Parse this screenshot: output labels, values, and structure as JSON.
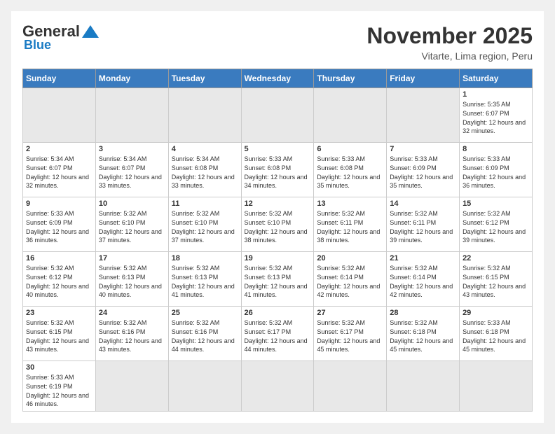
{
  "logo": {
    "general": "General",
    "blue": "Blue"
  },
  "title": "November 2025",
  "location": "Vitarte, Lima region, Peru",
  "days_of_week": [
    "Sunday",
    "Monday",
    "Tuesday",
    "Wednesday",
    "Thursday",
    "Friday",
    "Saturday"
  ],
  "weeks": [
    [
      {
        "num": "",
        "empty": true
      },
      {
        "num": "",
        "empty": true
      },
      {
        "num": "",
        "empty": true
      },
      {
        "num": "",
        "empty": true
      },
      {
        "num": "",
        "empty": true
      },
      {
        "num": "",
        "empty": true
      },
      {
        "num": "1",
        "sunrise": "5:35 AM",
        "sunset": "6:07 PM",
        "daylight": "12 hours and 32 minutes."
      }
    ],
    [
      {
        "num": "2",
        "sunrise": "5:34 AM",
        "sunset": "6:07 PM",
        "daylight": "12 hours and 32 minutes."
      },
      {
        "num": "3",
        "sunrise": "5:34 AM",
        "sunset": "6:07 PM",
        "daylight": "12 hours and 33 minutes."
      },
      {
        "num": "4",
        "sunrise": "5:34 AM",
        "sunset": "6:08 PM",
        "daylight": "12 hours and 33 minutes."
      },
      {
        "num": "5",
        "sunrise": "5:33 AM",
        "sunset": "6:08 PM",
        "daylight": "12 hours and 34 minutes."
      },
      {
        "num": "6",
        "sunrise": "5:33 AM",
        "sunset": "6:08 PM",
        "daylight": "12 hours and 35 minutes."
      },
      {
        "num": "7",
        "sunrise": "5:33 AM",
        "sunset": "6:09 PM",
        "daylight": "12 hours and 35 minutes."
      },
      {
        "num": "8",
        "sunrise": "5:33 AM",
        "sunset": "6:09 PM",
        "daylight": "12 hours and 36 minutes."
      }
    ],
    [
      {
        "num": "9",
        "sunrise": "5:33 AM",
        "sunset": "6:09 PM",
        "daylight": "12 hours and 36 minutes."
      },
      {
        "num": "10",
        "sunrise": "5:32 AM",
        "sunset": "6:10 PM",
        "daylight": "12 hours and 37 minutes."
      },
      {
        "num": "11",
        "sunrise": "5:32 AM",
        "sunset": "6:10 PM",
        "daylight": "12 hours and 37 minutes."
      },
      {
        "num": "12",
        "sunrise": "5:32 AM",
        "sunset": "6:10 PM",
        "daylight": "12 hours and 38 minutes."
      },
      {
        "num": "13",
        "sunrise": "5:32 AM",
        "sunset": "6:11 PM",
        "daylight": "12 hours and 38 minutes."
      },
      {
        "num": "14",
        "sunrise": "5:32 AM",
        "sunset": "6:11 PM",
        "daylight": "12 hours and 39 minutes."
      },
      {
        "num": "15",
        "sunrise": "5:32 AM",
        "sunset": "6:12 PM",
        "daylight": "12 hours and 39 minutes."
      }
    ],
    [
      {
        "num": "16",
        "sunrise": "5:32 AM",
        "sunset": "6:12 PM",
        "daylight": "12 hours and 40 minutes."
      },
      {
        "num": "17",
        "sunrise": "5:32 AM",
        "sunset": "6:13 PM",
        "daylight": "12 hours and 40 minutes."
      },
      {
        "num": "18",
        "sunrise": "5:32 AM",
        "sunset": "6:13 PM",
        "daylight": "12 hours and 41 minutes."
      },
      {
        "num": "19",
        "sunrise": "5:32 AM",
        "sunset": "6:13 PM",
        "daylight": "12 hours and 41 minutes."
      },
      {
        "num": "20",
        "sunrise": "5:32 AM",
        "sunset": "6:14 PM",
        "daylight": "12 hours and 42 minutes."
      },
      {
        "num": "21",
        "sunrise": "5:32 AM",
        "sunset": "6:14 PM",
        "daylight": "12 hours and 42 minutes."
      },
      {
        "num": "22",
        "sunrise": "5:32 AM",
        "sunset": "6:15 PM",
        "daylight": "12 hours and 43 minutes."
      }
    ],
    [
      {
        "num": "23",
        "sunrise": "5:32 AM",
        "sunset": "6:15 PM",
        "daylight": "12 hours and 43 minutes."
      },
      {
        "num": "24",
        "sunrise": "5:32 AM",
        "sunset": "6:16 PM",
        "daylight": "12 hours and 43 minutes."
      },
      {
        "num": "25",
        "sunrise": "5:32 AM",
        "sunset": "6:16 PM",
        "daylight": "12 hours and 44 minutes."
      },
      {
        "num": "26",
        "sunrise": "5:32 AM",
        "sunset": "6:17 PM",
        "daylight": "12 hours and 44 minutes."
      },
      {
        "num": "27",
        "sunrise": "5:32 AM",
        "sunset": "6:17 PM",
        "daylight": "12 hours and 45 minutes."
      },
      {
        "num": "28",
        "sunrise": "5:32 AM",
        "sunset": "6:18 PM",
        "daylight": "12 hours and 45 minutes."
      },
      {
        "num": "29",
        "sunrise": "5:33 AM",
        "sunset": "6:18 PM",
        "daylight": "12 hours and 45 minutes."
      }
    ],
    [
      {
        "num": "30",
        "sunrise": "5:33 AM",
        "sunset": "6:19 PM",
        "daylight": "12 hours and 46 minutes."
      },
      {
        "num": "",
        "empty": true
      },
      {
        "num": "",
        "empty": true
      },
      {
        "num": "",
        "empty": true
      },
      {
        "num": "",
        "empty": true
      },
      {
        "num": "",
        "empty": true
      },
      {
        "num": "",
        "empty": true
      }
    ]
  ],
  "labels": {
    "sunrise": "Sunrise:",
    "sunset": "Sunset:",
    "daylight": "Daylight:"
  }
}
